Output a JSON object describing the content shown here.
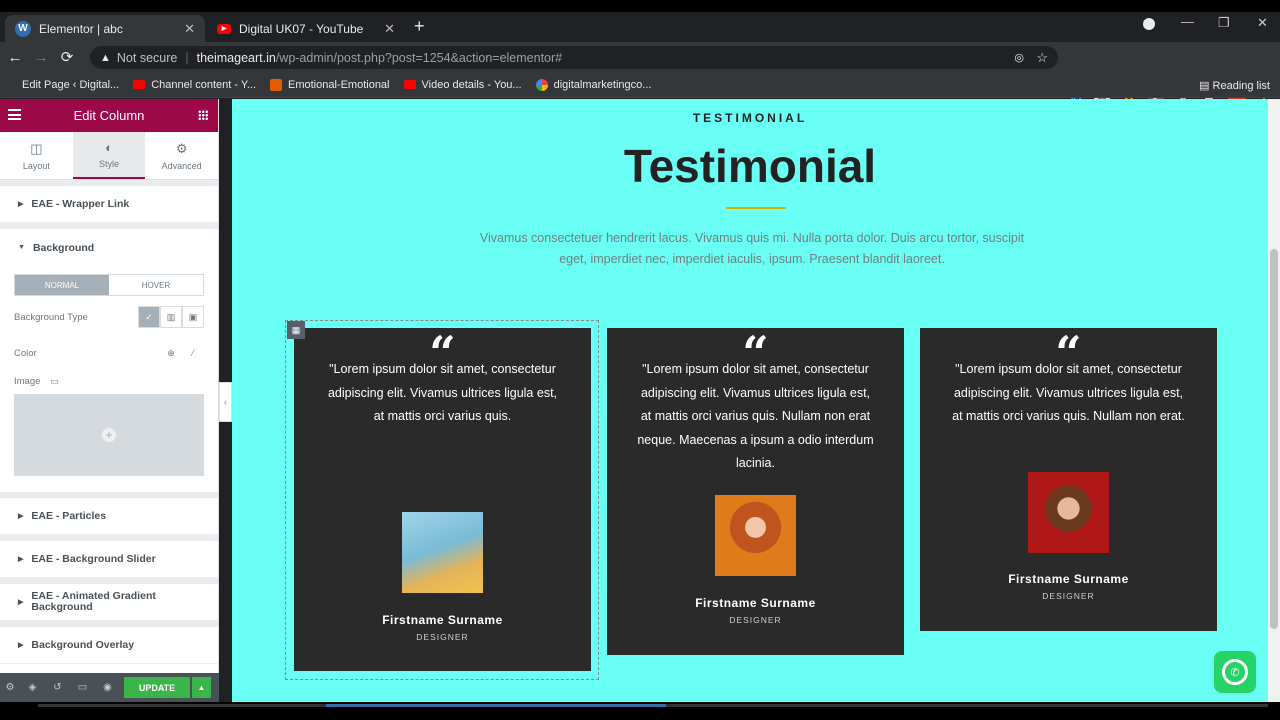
{
  "browser": {
    "tabs": [
      {
        "title": "Elementor | abc",
        "icon": "wordpress-icon"
      },
      {
        "title": "Digital UK07 - YouTube",
        "icon": "youtube-icon"
      }
    ],
    "address": {
      "security": "Not secure",
      "host": "theimageart.in",
      "path": "/wp-admin/post.php?post=1254&action=elementor#"
    },
    "bookmarks": [
      {
        "label": "Edit Page ‹ Digital...",
        "icon": "wordpress-icon"
      },
      {
        "label": "Channel content - Y...",
        "icon": "youtube-icon"
      },
      {
        "label": "Emotional-Emotional",
        "icon": "g-icon"
      },
      {
        "label": "Video details - You...",
        "icon": "youtube-icon"
      },
      {
        "label": "digitalmarketingco...",
        "icon": "google-icon"
      }
    ],
    "reading_list": "Reading list",
    "colors": {
      "accent": "#9b0a46",
      "canvas": "#69fff5",
      "card": "#2a2a2a",
      "update": "#39b54a"
    }
  },
  "panel": {
    "title": "Edit Column",
    "tabs": [
      {
        "label": "Layout",
        "icon": "layout-icon"
      },
      {
        "label": "Style",
        "icon": "style-icon"
      },
      {
        "label": "Advanced",
        "icon": "gear-icon"
      }
    ],
    "sections": {
      "wrapper_link": "EAE - Wrapper Link",
      "background": "Background",
      "particles": "EAE - Particles",
      "bg_slider": "EAE - Background Slider",
      "anim_gradient": "EAE - Animated Gradient Background",
      "overlay": "Background Overlay"
    },
    "state_tabs": {
      "normal": "NORMAL",
      "hover": "HOVER"
    },
    "bg_type_label": "Background Type",
    "color_label": "Color",
    "image_label": "Image",
    "update_label": "UPDATE"
  },
  "page": {
    "kicker": "TESTIMONIAL",
    "title": "Testimonial",
    "description": "Vivamus consectetuer hendrerit lacus. Vivamus quis mi. Nulla porta dolor. Duis arcu tortor, suscipit eget, imperdiet nec, imperdiet iaculis, ipsum. Praesent blandit laoreet.",
    "cards": [
      {
        "quote": "\"Lorem ipsum dolor sit amet, consectetur adipiscing elit. Vivamus ultrices ligula est, at mattis orci varius quis.",
        "name": "Firstname Surname",
        "role": "DESIGNER"
      },
      {
        "quote": "\"Lorem ipsum dolor sit amet, consectetur adipiscing elit. Vivamus ultrices ligula est, at mattis orci varius quis. Nullam non erat neque. Maecenas a ipsum a odio interdum lacinia.",
        "name": "Firstname Surname",
        "role": "DESIGNER"
      },
      {
        "quote": "\"Lorem ipsum dolor sit amet, consectetur adipiscing elit. Vivamus ultrices ligula est, at mattis orci varius quis. Nullam non erat.",
        "name": "Firstname Surname",
        "role": "DESIGNER"
      }
    ]
  }
}
